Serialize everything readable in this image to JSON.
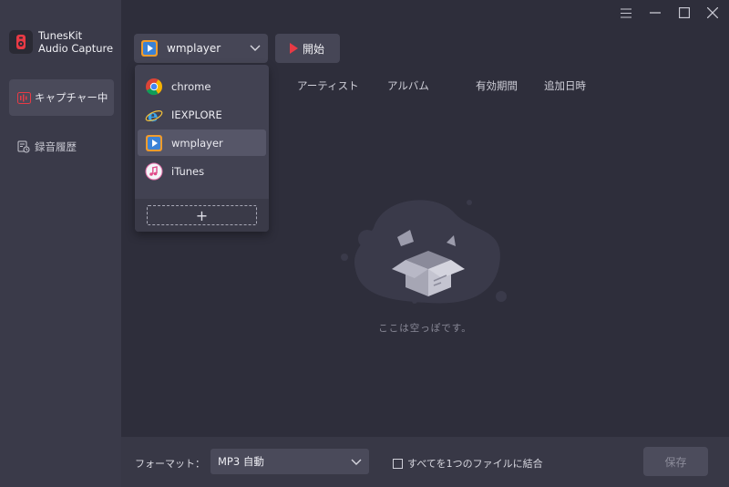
{
  "app": {
    "name_line1": "TunesKit",
    "name_line2": "Audio Capture"
  },
  "sidebar": {
    "items": [
      {
        "label": "キャプチャー中",
        "active": true,
        "icon": "capture-icon"
      },
      {
        "label": "録音履歴",
        "active": false,
        "icon": "history-icon"
      }
    ]
  },
  "titlebar": {
    "icons": [
      "menu-icon",
      "minimize-icon",
      "maximize-icon",
      "close-icon"
    ]
  },
  "toolbar": {
    "selected_app": "wmplayer",
    "start_label": "開始"
  },
  "columns": {
    "artist": "アーティスト",
    "album": "アルバム",
    "duration": "有効期間",
    "date_added": "追加日時"
  },
  "app_dropdown": {
    "items": [
      {
        "label": "chrome",
        "icon": "chrome-icon"
      },
      {
        "label": "IEXPLORE",
        "icon": "ie-icon"
      },
      {
        "label": "wmplayer",
        "icon": "wmplayer-icon",
        "selected": true
      },
      {
        "label": "iTunes",
        "icon": "itunes-icon"
      }
    ],
    "add_label": "+"
  },
  "empty_state": {
    "message": "ここは空っぽです。"
  },
  "bottom": {
    "format_label": "フォーマット：",
    "format_value": "MP3 自動",
    "merge_label": "すべてを1つのファイルに結合",
    "save_label": "保存"
  },
  "colors": {
    "background": "#2e2e3b",
    "sidebar": "#3a3a49",
    "accent_red": "#e83a45"
  }
}
